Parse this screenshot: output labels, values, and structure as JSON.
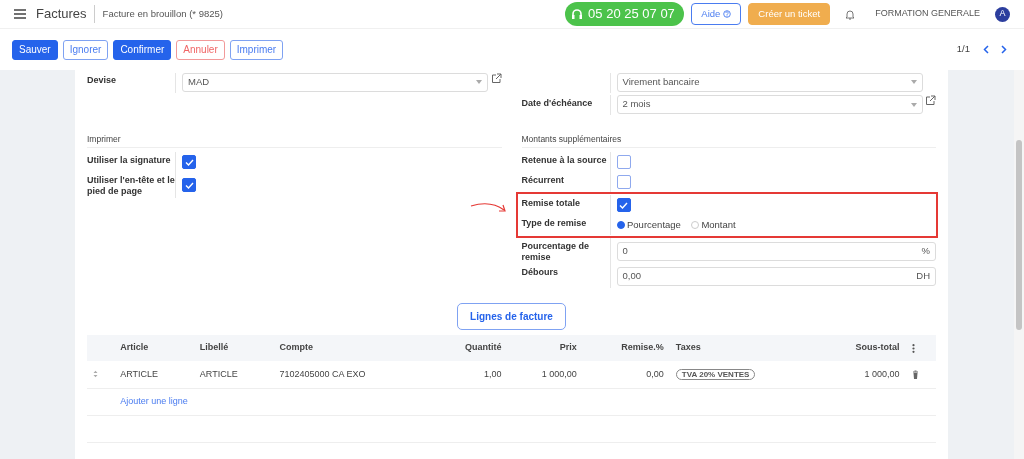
{
  "navbar": {
    "app_title": "Factures",
    "breadcrumb": "Facture en brouillon (* 9825)",
    "phone": "05 20 25 07 07",
    "help_button": "Aide",
    "ticket_button": "Créer un ticket",
    "company": "FORMATION GENERALE",
    "avatar_initial": "A"
  },
  "actions": [
    {
      "label": "Sauver",
      "kind": "primary"
    },
    {
      "label": "Ignorer",
      "kind": "outline"
    },
    {
      "label": "Confirmer",
      "kind": "primary"
    },
    {
      "label": "Annuler",
      "kind": "danger"
    },
    {
      "label": "Imprimer",
      "kind": "outline"
    }
  ],
  "pager": "1/1",
  "top_fields": {
    "left": [
      {
        "label": "Devise",
        "value": "MAD",
        "link": true
      }
    ],
    "right": [
      {
        "value": "Virement bancaire",
        "link": false
      },
      {
        "label": "Date d'échéance",
        "value": "2 mois",
        "link": true
      }
    ]
  },
  "groups": [
    {
      "title": "Imprimer",
      "rows": [
        {
          "label": "Utiliser la signature",
          "kind": "checkbox",
          "checked": true,
          "highlighted": false
        },
        {
          "label": "Utiliser l'en-tête et le pied de page",
          "kind": "checkbox",
          "checked": true,
          "highlighted": false
        }
      ]
    },
    {
      "title": "Montants supplémentaires",
      "rows": [
        {
          "label": "Retenue à la source",
          "kind": "checkbox",
          "checked": false,
          "highlighted": false
        },
        {
          "label": "Récurrent",
          "kind": "checkbox",
          "checked": false,
          "highlighted": false
        },
        {
          "label": "Remise totale",
          "kind": "checkbox",
          "checked": true,
          "highlighted": true
        },
        {
          "label": "Type de remise",
          "kind": "radio",
          "highlighted": true,
          "options": [
            {
              "label": "Pourcentage",
              "selected": true
            },
            {
              "label": "Montant",
              "selected": false
            }
          ]
        },
        {
          "label": "Pourcentage de remise",
          "kind": "input",
          "value": "0",
          "unit": "%",
          "highlighted": false
        },
        {
          "label": "Débours",
          "kind": "input",
          "value": "0,00",
          "unit": "DH",
          "highlighted": false
        }
      ]
    }
  ],
  "section_button": "Lignes de facture",
  "table": {
    "columns": [
      {
        "label": "Article",
        "kind": "text"
      },
      {
        "label": "Libellé",
        "kind": "text"
      },
      {
        "label": "Compte",
        "kind": "text"
      },
      {
        "label": "Quantité",
        "kind": "number"
      },
      {
        "label": "Prix",
        "kind": "number"
      },
      {
        "label": "Remise.%",
        "kind": "number"
      },
      {
        "label": "Taxes",
        "kind": "tag"
      },
      {
        "label": "Sous-total",
        "kind": "number"
      }
    ],
    "rows": [
      {
        "cells": [
          "ARTICLE",
          "ARTICLE",
          "7102405000 CA EXO",
          "1,00",
          "1 000,00",
          "0,00",
          "TVA 20% VENTES",
          "1 000,00"
        ]
      }
    ],
    "add_line": "Ajouter une ligne"
  }
}
